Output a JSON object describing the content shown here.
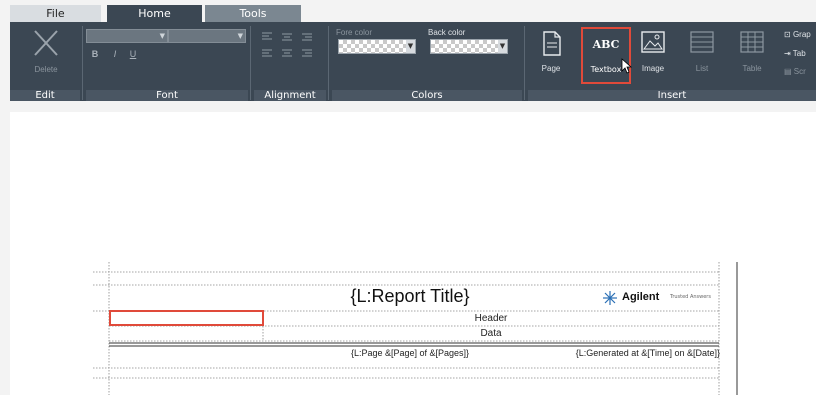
{
  "tabs": {
    "file": "File",
    "home": "Home",
    "tools": "Tools"
  },
  "groups": {
    "edit": "Edit",
    "font": "Font",
    "alignment": "Alignment",
    "colors": "Colors",
    "insert": "Insert"
  },
  "edit": {
    "delete": "Delete"
  },
  "font": {
    "bold": "B",
    "italic": "I",
    "underline": "U"
  },
  "colors": {
    "fore": "Fore color",
    "back": "Back color",
    "fore_value": "transparent",
    "back_value": "transparent"
  },
  "insert": {
    "page": "Page",
    "textbox": "Textbox",
    "textbox_icon": "ABC",
    "image": "Image",
    "list": "List",
    "table": "Table",
    "graph": "Grap",
    "tab": "Tab",
    "scr": "Scr"
  },
  "report": {
    "title": "{L:Report Title}",
    "logo_name": "Agilent",
    "logo_tagline": "Trusted Answers",
    "header": "Header",
    "data": "Data",
    "page_footer": "{L:Page &[Page] of &[Pages]}",
    "generated_footer": "{L:Generated at &[Time] on &[Date]}"
  },
  "colors_ui": {
    "selection": "#e04a3a",
    "ribbon": "#3b4753",
    "active_tab": "#3b4753"
  }
}
